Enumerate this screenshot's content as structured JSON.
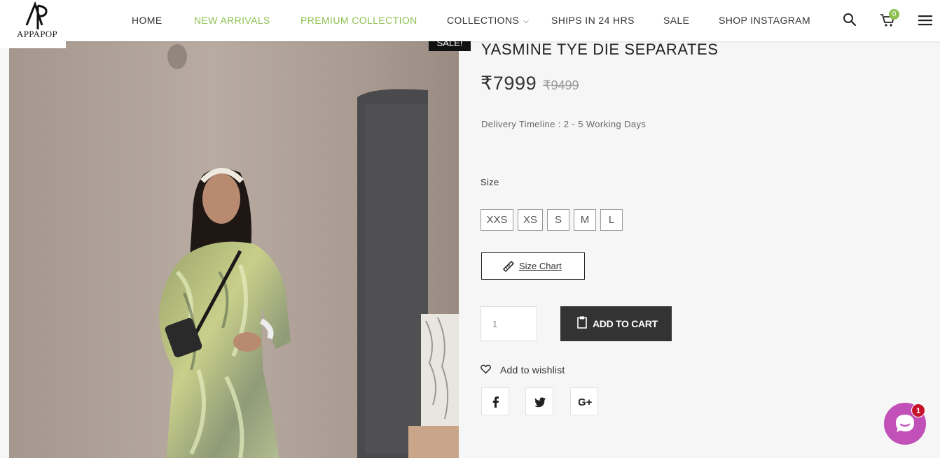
{
  "logo": {
    "text": "APPAPOP"
  },
  "nav": {
    "items": [
      {
        "label": "HOME"
      },
      {
        "label": "NEW ARRIVALS"
      },
      {
        "label": "PREMIUM COLLECTION"
      },
      {
        "label": "COLLECTIONS"
      },
      {
        "label": "SHIPS IN 24 HRS"
      },
      {
        "label": "SALE"
      },
      {
        "label": "SHOP INSTAGRAM"
      }
    ],
    "accent_color": "#8dc150",
    "cart_count": "0"
  },
  "product": {
    "sale_badge": "SALE!",
    "title": "YASMINE TYE DIE SEPARATES",
    "price": "₹7999",
    "old_price": "₹9499",
    "delivery": "Delivery Timeline : 2 - 5 Working Days",
    "size_label": "Size",
    "sizes": [
      "XXS",
      "XS",
      "S",
      "M",
      "L"
    ],
    "size_chart_label": "Size Chart",
    "quantity": "1",
    "add_to_cart_label": "ADD TO CART",
    "wishlist_label": "Add to wishlist",
    "social": [
      "facebook-icon",
      "twitter-icon",
      "google-plus-icon"
    ]
  },
  "chat": {
    "badge": "1",
    "color": "#c150b8"
  }
}
